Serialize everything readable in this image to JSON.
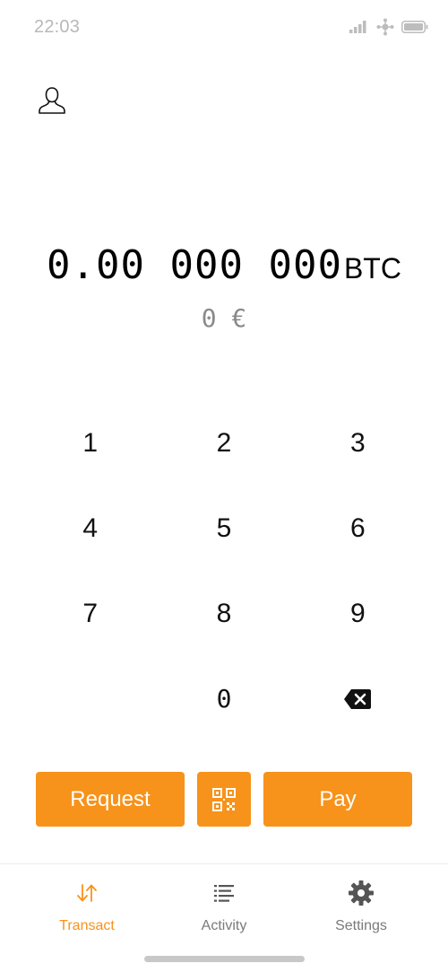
{
  "status_bar": {
    "time": "22:03",
    "icons": [
      "signal-icon",
      "network-icon",
      "battery-icon"
    ]
  },
  "header": {
    "account_icon": "person-outline-icon"
  },
  "amount": {
    "value": "0.00 000 000",
    "unit": "BTC",
    "fiat": "0 €"
  },
  "keypad": {
    "keys": [
      "1",
      "2",
      "3",
      "4",
      "5",
      "6",
      "7",
      "8",
      "9",
      "",
      "0",
      "backspace"
    ],
    "backspace_icon": "backspace-icon"
  },
  "actions": {
    "request_label": "Request",
    "scan_icon": "qr-code-icon",
    "pay_label": "Pay"
  },
  "bottom_nav": {
    "items": [
      {
        "label": "Transact",
        "icon": "transfer-arrows-icon",
        "active": true
      },
      {
        "label": "Activity",
        "icon": "list-icon",
        "active": false
      },
      {
        "label": "Settings",
        "icon": "gear-icon",
        "active": false
      }
    ]
  },
  "colors": {
    "accent": "#f7931a",
    "text": "#111111",
    "muted": "#8a8a8a",
    "status": "#b8b8b8"
  }
}
